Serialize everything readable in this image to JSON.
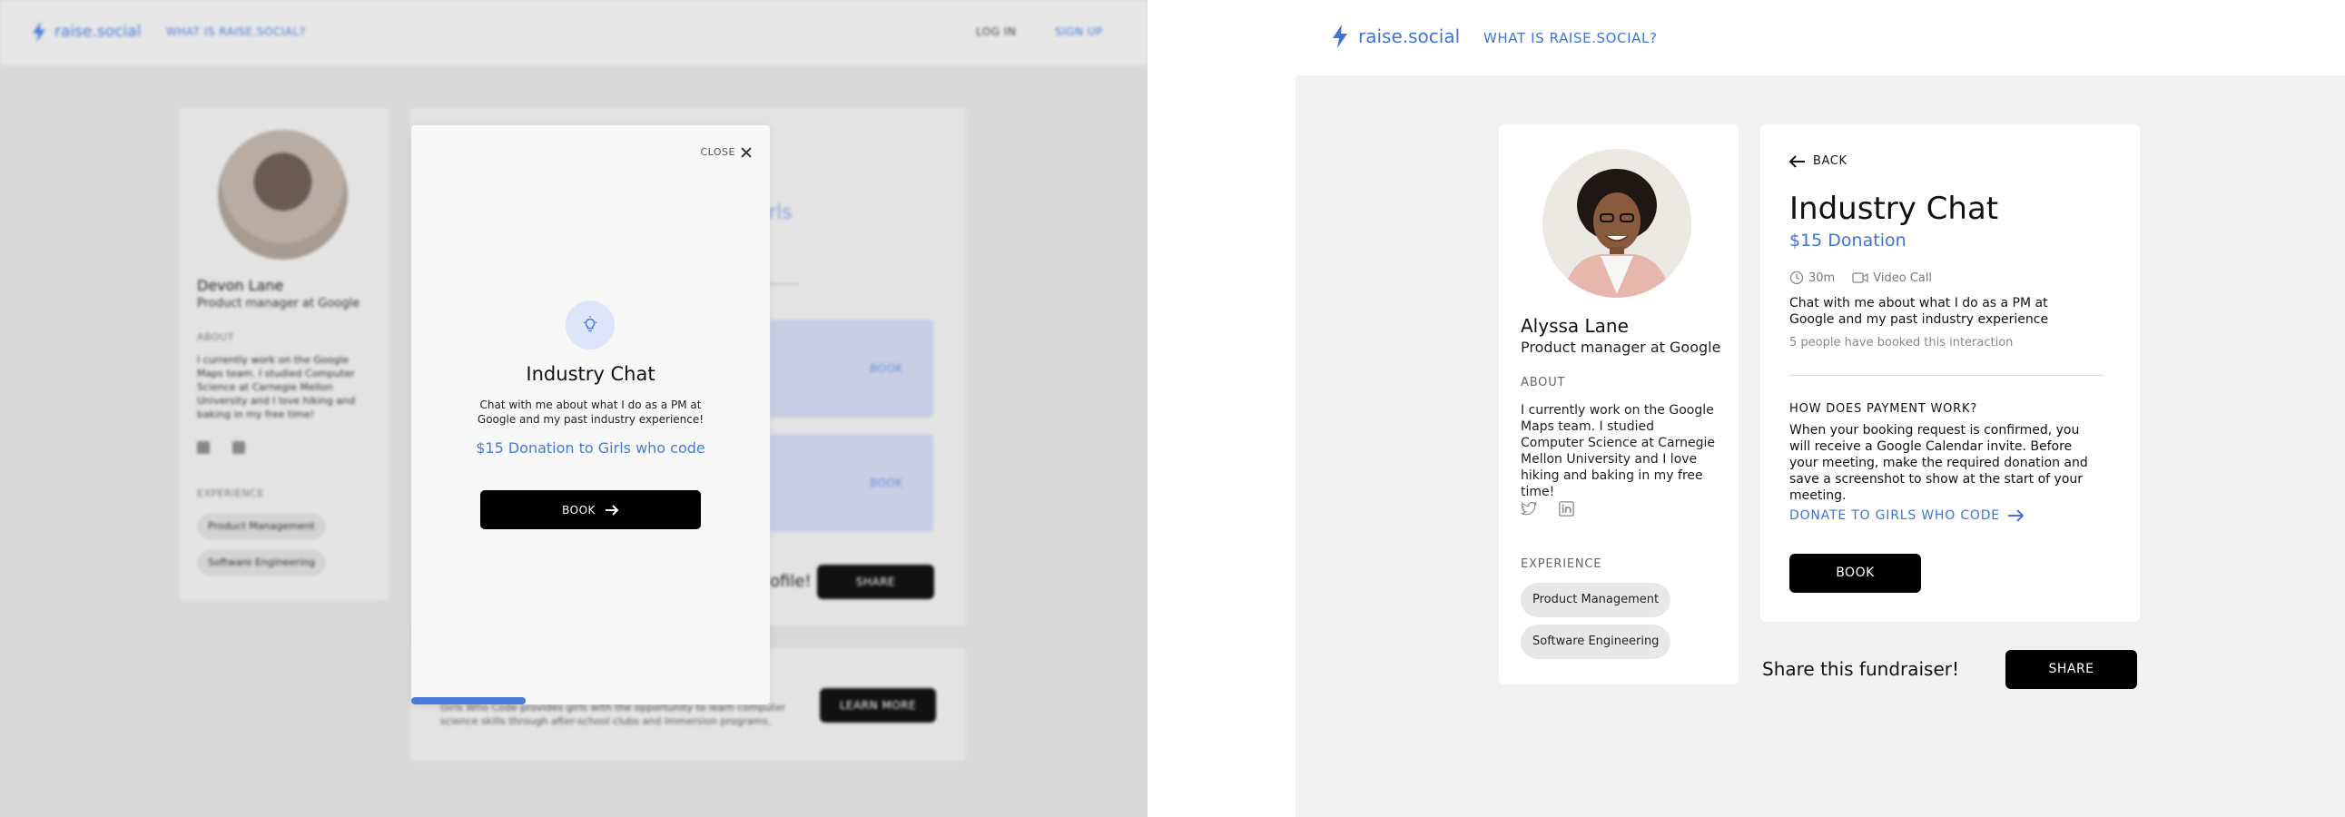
{
  "colors": {
    "accent": "#3f74d6",
    "button_bg": "#000000",
    "page_bg": "#f1f1f1",
    "overlay_bg": "#d9d9d9"
  },
  "mobile": {
    "header": {
      "logo_text": "raise.social",
      "what_is": "WHAT IS RAISE.SOCIAL?",
      "login": "LOG IN",
      "signup": "SIGN UP"
    },
    "profile": {
      "name": "Devon Lane",
      "title": "Product manager at Google",
      "about_heading": "ABOUT",
      "about_text": "I currently work on the Google Maps team. I studied Computer Science at Carnegie Mellon University and I love hiking and baking in my free time!",
      "experience_heading": "EXPERIENCE",
      "experience": [
        "Product Management",
        "Software Engineering"
      ]
    },
    "background": {
      "title_fragment": "irls",
      "slot_book_1": "BOOK",
      "slot_book_2": "BOOK",
      "share_text": "ofile!",
      "share_button": "SHARE",
      "learn_text": "Girls Who Code provides girls with the opportunity to learn computer science skills through after-school clubs and immersion programs.",
      "learn_button": "LEARN MORE"
    },
    "modal": {
      "close_label": "CLOSE",
      "title": "Industry Chat",
      "description": "Chat with me about what I do as a PM at Google and my past industry experience!",
      "donation": "$15 Donation to Girls who code",
      "book_label": "BOOK",
      "progress_fraction": 0.32,
      "icon": "lightbulb-icon"
    }
  },
  "desktop": {
    "header": {
      "logo_text": "raise.social",
      "what_is": "WHAT IS RAISE.SOCIAL?"
    },
    "profile": {
      "name": "Alyssa Lane",
      "title": "Product manager at Google",
      "about_heading": "ABOUT",
      "about_text": "I currently work on the Google Maps team. I studied Computer Science at Carnegie Mellon University and I love hiking and baking in my free time!",
      "experience_heading": "EXPERIENCE",
      "experience": [
        "Product Management",
        "Software Engineering"
      ]
    },
    "detail": {
      "back_label": "BACK",
      "title": "Industry Chat",
      "donation": "$15 Donation",
      "duration": "30m",
      "call_type": "Video Call",
      "description": "Chat with me about what I do as a PM at Google and my past industry experience",
      "booked_count": "5 people have booked this interaction",
      "payment_heading": "HOW DOES PAYMENT WORK?",
      "payment_text": "When your booking request is confirmed, you will receive a Google Calendar invite. Before your meeting, make the required donation and save a screenshot to show at the start of your meeting.",
      "donate_link": "DONATE TO GIRLS WHO CODE",
      "book_label": "BOOK"
    },
    "share": {
      "text": "Share this fundraiser!",
      "button": "SHARE"
    }
  }
}
